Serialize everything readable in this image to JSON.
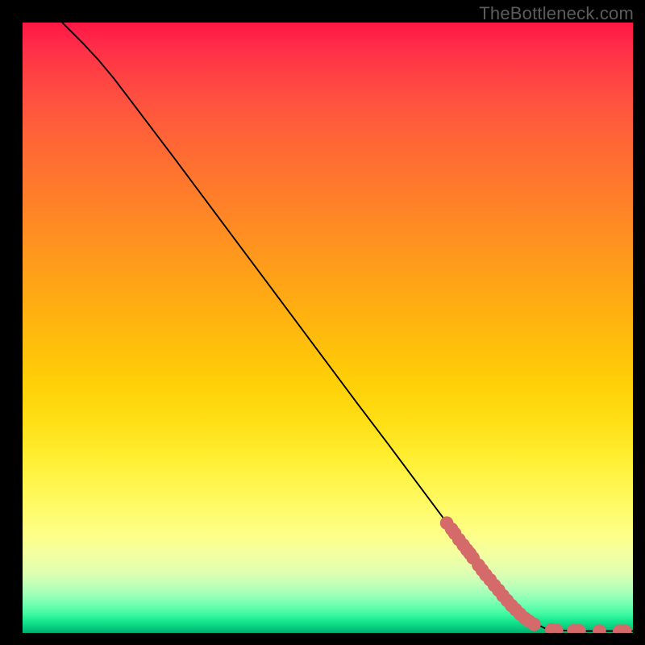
{
  "watermark": "TheBottleneck.com",
  "chart_data": {
    "type": "line",
    "title": "",
    "xlabel": "",
    "ylabel": "",
    "xlim": [
      0,
      100
    ],
    "ylim": [
      0,
      100
    ],
    "curve": [
      {
        "x": 6.5,
        "y": 100
      },
      {
        "x": 8.0,
        "y": 98.5
      },
      {
        "x": 10.0,
        "y": 96.5
      },
      {
        "x": 12.5,
        "y": 93.8
      },
      {
        "x": 15.0,
        "y": 90.8
      },
      {
        "x": 20.0,
        "y": 84.2
      },
      {
        "x": 25.0,
        "y": 77.6
      },
      {
        "x": 30.0,
        "y": 70.9
      },
      {
        "x": 35.0,
        "y": 64.2
      },
      {
        "x": 40.0,
        "y": 57.5
      },
      {
        "x": 45.0,
        "y": 50.8
      },
      {
        "x": 50.0,
        "y": 44.1
      },
      {
        "x": 55.0,
        "y": 37.4
      },
      {
        "x": 60.0,
        "y": 30.8
      },
      {
        "x": 65.0,
        "y": 24.1
      },
      {
        "x": 70.0,
        "y": 17.4
      },
      {
        "x": 75.0,
        "y": 10.7
      },
      {
        "x": 80.0,
        "y": 4.8
      },
      {
        "x": 83.0,
        "y": 2.0
      },
      {
        "x": 85.5,
        "y": 0.8
      },
      {
        "x": 88.0,
        "y": 0.4
      },
      {
        "x": 92.0,
        "y": 0.3
      },
      {
        "x": 96.0,
        "y": 0.3
      },
      {
        "x": 100.0,
        "y": 0.3
      }
    ],
    "markers": [
      {
        "x": 69.5,
        "y": 18.0
      },
      {
        "x": 70.3,
        "y": 17.0
      },
      {
        "x": 70.8,
        "y": 16.3
      },
      {
        "x": 71.5,
        "y": 15.3
      },
      {
        "x": 72.2,
        "y": 14.4
      },
      {
        "x": 72.8,
        "y": 13.6
      },
      {
        "x": 73.3,
        "y": 13.0
      },
      {
        "x": 73.8,
        "y": 12.3
      },
      {
        "x": 74.7,
        "y": 11.1
      },
      {
        "x": 75.3,
        "y": 10.3
      },
      {
        "x": 75.9,
        "y": 9.5
      },
      {
        "x": 76.6,
        "y": 8.7
      },
      {
        "x": 77.3,
        "y": 7.8
      },
      {
        "x": 78.0,
        "y": 7.0
      },
      {
        "x": 78.7,
        "y": 6.1
      },
      {
        "x": 79.4,
        "y": 5.3
      },
      {
        "x": 80.1,
        "y": 4.5
      },
      {
        "x": 80.8,
        "y": 3.8
      },
      {
        "x": 81.5,
        "y": 3.1
      },
      {
        "x": 82.3,
        "y": 2.4
      },
      {
        "x": 83.0,
        "y": 1.9
      },
      {
        "x": 83.8,
        "y": 1.4
      },
      {
        "x": 86.7,
        "y": 0.5
      },
      {
        "x": 87.5,
        "y": 0.4
      },
      {
        "x": 90.3,
        "y": 0.35
      },
      {
        "x": 91.2,
        "y": 0.35
      },
      {
        "x": 94.5,
        "y": 0.3
      },
      {
        "x": 97.8,
        "y": 0.3
      },
      {
        "x": 98.7,
        "y": 0.3
      }
    ],
    "marker_color": "#d46a6a",
    "marker_radius_pct": 1.1,
    "line_color": "#000000"
  }
}
